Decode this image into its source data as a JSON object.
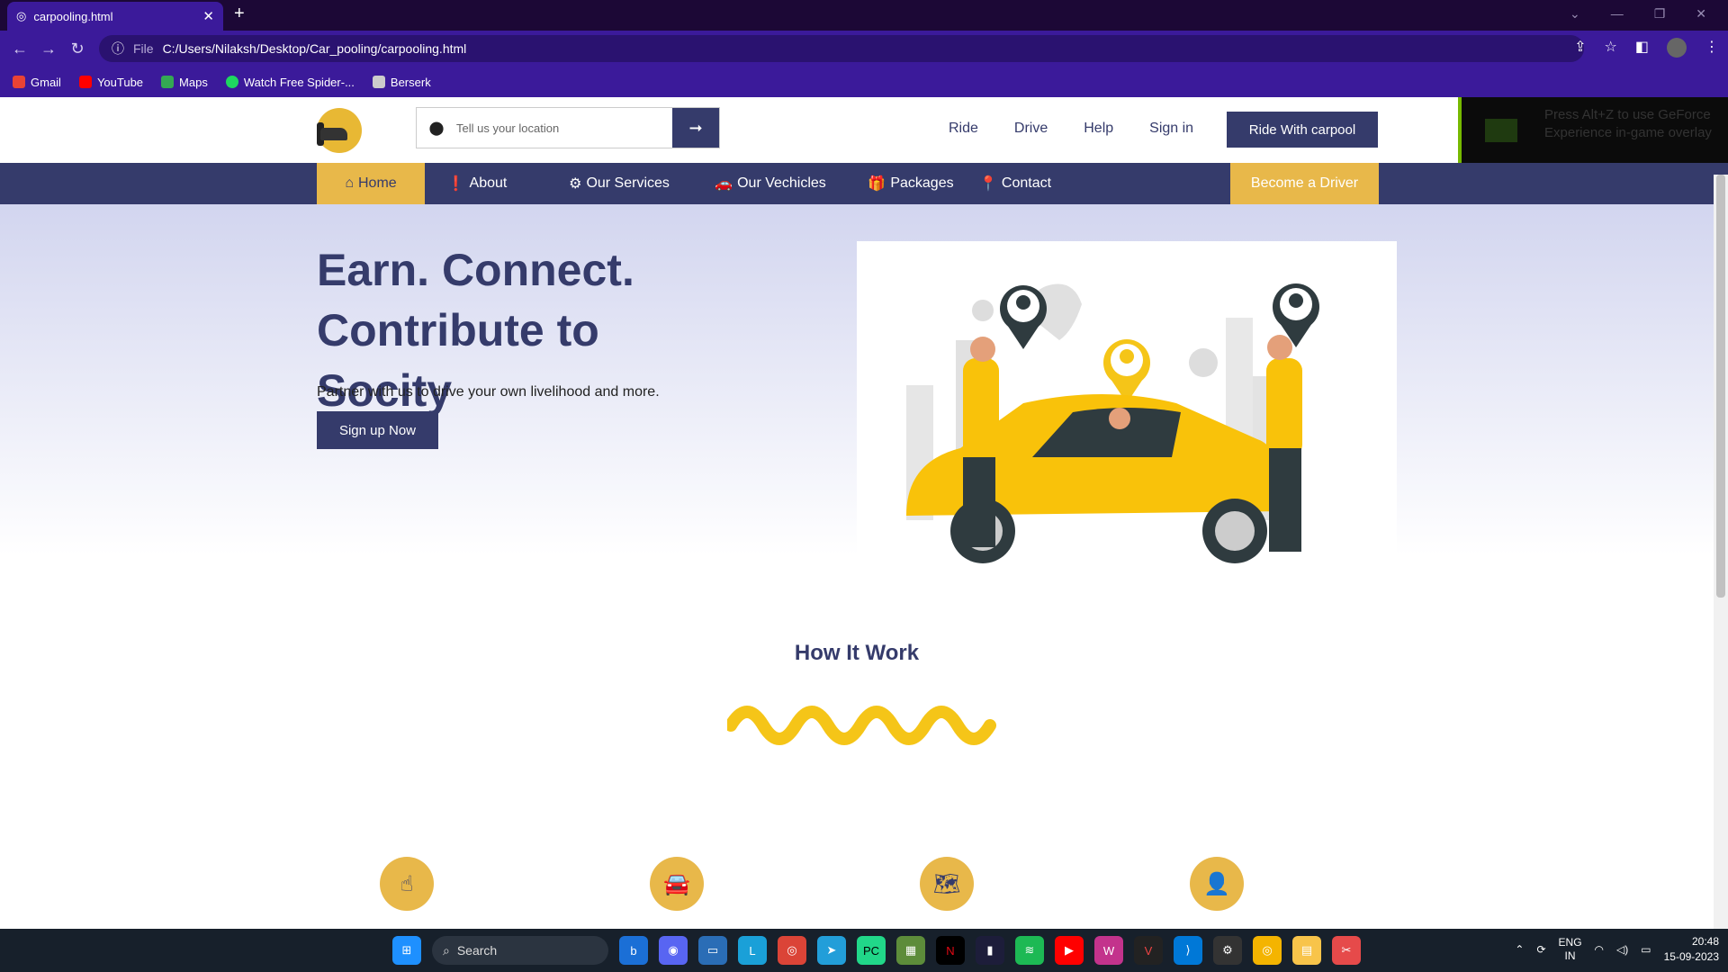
{
  "browser": {
    "tab_title": "carpooling.html",
    "url_scheme": "File",
    "url": "C:/Users/Nilaksh/Desktop/Car_pooling/carpooling.html",
    "bookmarks": [
      {
        "label": "Gmail",
        "color": "#ea4335"
      },
      {
        "label": "YouTube",
        "color": "#ff0000"
      },
      {
        "label": "Maps",
        "color": "#34a853"
      },
      {
        "label": "Watch Free Spider-...",
        "color": "#1ed760"
      },
      {
        "label": "Berserk",
        "color": "#cccccc"
      }
    ]
  },
  "header": {
    "search_placeholder": "Tell us your location",
    "links": [
      "Ride",
      "Drive",
      "Help",
      "Sign in"
    ],
    "cta": "Ride With carpool"
  },
  "overlay": {
    "text": "Press Alt+Z to use GeForce Experience in-game overlay"
  },
  "nav": {
    "items": [
      "Home",
      "About",
      "Our Services",
      "Our Vechicles",
      "Packages",
      "Contact"
    ],
    "driver_button": "Become a Driver"
  },
  "hero": {
    "heading": "Earn. Connect. Contribute to Socity",
    "subtext": "Partner with us to drive your own livelihood and more.",
    "button": "Sign up Now"
  },
  "how_it_works": {
    "title": "How It Work"
  },
  "taskbar": {
    "search": "Search",
    "lang": "ENG",
    "region": "IN",
    "time": "20:48",
    "date": "15-09-2023"
  },
  "colors": {
    "primary": "#353b6b",
    "accent": "#e8b84a",
    "browser": "#3b1a9a"
  }
}
